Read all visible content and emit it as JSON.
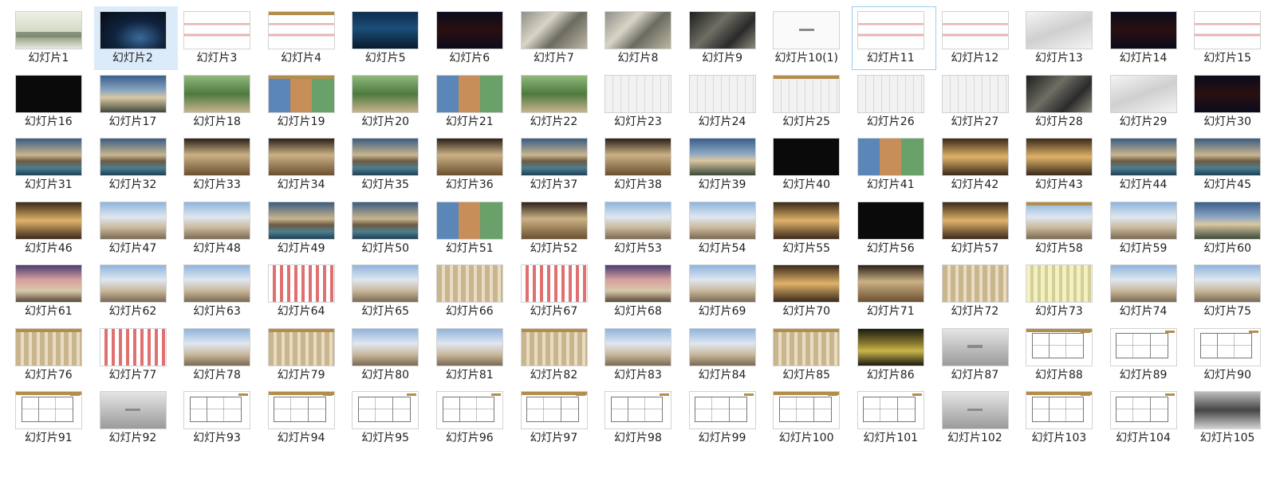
{
  "slide_prefix": "幻灯片",
  "selected_index": 1,
  "hover_index": 10,
  "slides": [
    {
      "label": "幻灯片1",
      "thumb": "fog"
    },
    {
      "label": "幻灯片2",
      "thumb": "night"
    },
    {
      "label": "幻灯片3",
      "thumb": "planred"
    },
    {
      "label": "幻灯片4",
      "thumb": "planred"
    },
    {
      "label": "幻灯片5",
      "thumb": "nightsky"
    },
    {
      "label": "幻灯片6",
      "thumb": "blueprint"
    },
    {
      "label": "幻灯片7",
      "thumb": "aerial"
    },
    {
      "label": "幻灯片8",
      "thumb": "aerial"
    },
    {
      "label": "幻灯片9",
      "thumb": "aerialdark"
    },
    {
      "label": "幻灯片10(1)",
      "thumb": "white"
    },
    {
      "label": "幻灯片11",
      "thumb": "planred"
    },
    {
      "label": "幻灯片12",
      "thumb": "planred"
    },
    {
      "label": "幻灯片13",
      "thumb": "axo"
    },
    {
      "label": "幻灯片14",
      "thumb": "blueprint"
    },
    {
      "label": "幻灯片15",
      "thumb": "planred"
    },
    {
      "label": "幻灯片16",
      "thumb": "dark"
    },
    {
      "label": "幻灯片17",
      "thumb": "dusk"
    },
    {
      "label": "幻灯片18",
      "thumb": "garden"
    },
    {
      "label": "幻灯片19",
      "thumb": "collage"
    },
    {
      "label": "幻灯片20",
      "thumb": "garden"
    },
    {
      "label": "幻灯片21",
      "thumb": "collage"
    },
    {
      "label": "幻灯片22",
      "thumb": "garden"
    },
    {
      "label": "幻灯片23",
      "thumb": "plan"
    },
    {
      "label": "幻灯片24",
      "thumb": "plan"
    },
    {
      "label": "幻灯片25",
      "thumb": "plan"
    },
    {
      "label": "幻灯片26",
      "thumb": "plan"
    },
    {
      "label": "幻灯片27",
      "thumb": "plan"
    },
    {
      "label": "幻灯片28",
      "thumb": "aerialdark"
    },
    {
      "label": "幻灯片29",
      "thumb": "axo"
    },
    {
      "label": "幻灯片30",
      "thumb": "blueprint"
    },
    {
      "label": "幻灯片31",
      "thumb": "pool"
    },
    {
      "label": "幻灯片32",
      "thumb": "pool"
    },
    {
      "label": "幻灯片33",
      "thumb": "lobby"
    },
    {
      "label": "幻灯片34",
      "thumb": "lobby"
    },
    {
      "label": "幻灯片35",
      "thumb": "pool"
    },
    {
      "label": "幻灯片36",
      "thumb": "lobby"
    },
    {
      "label": "幻灯片37",
      "thumb": "pool"
    },
    {
      "label": "幻灯片38",
      "thumb": "lobby"
    },
    {
      "label": "幻灯片39",
      "thumb": "dusk"
    },
    {
      "label": "幻灯片40",
      "thumb": "dark"
    },
    {
      "label": "幻灯片41",
      "thumb": "collage"
    },
    {
      "label": "幻灯片42",
      "thumb": "gold"
    },
    {
      "label": "幻灯片43",
      "thumb": "gold"
    },
    {
      "label": "幻灯片44",
      "thumb": "pool"
    },
    {
      "label": "幻灯片45",
      "thumb": "pool"
    },
    {
      "label": "幻灯片46",
      "thumb": "gold"
    },
    {
      "label": "幻灯片47",
      "thumb": "tower"
    },
    {
      "label": "幻灯片48",
      "thumb": "tower"
    },
    {
      "label": "幻灯片49",
      "thumb": "pool"
    },
    {
      "label": "幻灯片50",
      "thumb": "pool"
    },
    {
      "label": "幻灯片51",
      "thumb": "collage"
    },
    {
      "label": "幻灯片52",
      "thumb": "lobby"
    },
    {
      "label": "幻灯片53",
      "thumb": "tower"
    },
    {
      "label": "幻灯片54",
      "thumb": "tower"
    },
    {
      "label": "幻灯片55",
      "thumb": "gold"
    },
    {
      "label": "幻灯片56",
      "thumb": "dark"
    },
    {
      "label": "幻灯片57",
      "thumb": "gold"
    },
    {
      "label": "幻灯片58",
      "thumb": "tower"
    },
    {
      "label": "幻灯片59",
      "thumb": "tower"
    },
    {
      "label": "幻灯片60",
      "thumb": "dusk"
    },
    {
      "label": "幻灯片61",
      "thumb": "towerdusk"
    },
    {
      "label": "幻灯片62",
      "thumb": "tower"
    },
    {
      "label": "幻灯片63",
      "thumb": "tower"
    },
    {
      "label": "幻灯片64",
      "thumb": "facadered"
    },
    {
      "label": "幻灯片65",
      "thumb": "tower"
    },
    {
      "label": "幻灯片66",
      "thumb": "facade"
    },
    {
      "label": "幻灯片67",
      "thumb": "facadered"
    },
    {
      "label": "幻灯片68",
      "thumb": "towerdusk"
    },
    {
      "label": "幻灯片69",
      "thumb": "tower"
    },
    {
      "label": "幻灯片70",
      "thumb": "gold"
    },
    {
      "label": "幻灯片71",
      "thumb": "lobby"
    },
    {
      "label": "幻灯片72",
      "thumb": "facade"
    },
    {
      "label": "幻灯片73",
      "thumb": "facadeyel"
    },
    {
      "label": "幻灯片74",
      "thumb": "tower"
    },
    {
      "label": "幻灯片75",
      "thumb": "tower"
    },
    {
      "label": "幻灯片76",
      "thumb": "facade"
    },
    {
      "label": "幻灯片77",
      "thumb": "facadered"
    },
    {
      "label": "幻灯片78",
      "thumb": "tower"
    },
    {
      "label": "幻灯片79",
      "thumb": "facade"
    },
    {
      "label": "幻灯片80",
      "thumb": "tower"
    },
    {
      "label": "幻灯片81",
      "thumb": "tower"
    },
    {
      "label": "幻灯片82",
      "thumb": "facade"
    },
    {
      "label": "幻灯片83",
      "thumb": "tower"
    },
    {
      "label": "幻灯片84",
      "thumb": "tower"
    },
    {
      "label": "幻灯片85",
      "thumb": "facade"
    },
    {
      "label": "幻灯片86",
      "thumb": "cityeve"
    },
    {
      "label": "幻灯片87",
      "thumb": "gray"
    },
    {
      "label": "幻灯片88",
      "thumb": "floor"
    },
    {
      "label": "幻灯片89",
      "thumb": "floor"
    },
    {
      "label": "幻灯片90",
      "thumb": "floor"
    },
    {
      "label": "幻灯片91",
      "thumb": "floor"
    },
    {
      "label": "幻灯片92",
      "thumb": "gray"
    },
    {
      "label": "幻灯片93",
      "thumb": "floor"
    },
    {
      "label": "幻灯片94",
      "thumb": "floor"
    },
    {
      "label": "幻灯片95",
      "thumb": "floor"
    },
    {
      "label": "幻灯片96",
      "thumb": "floor"
    },
    {
      "label": "幻灯片97",
      "thumb": "floor"
    },
    {
      "label": "幻灯片98",
      "thumb": "floor"
    },
    {
      "label": "幻灯片99",
      "thumb": "floor"
    },
    {
      "label": "幻灯片100",
      "thumb": "floor"
    },
    {
      "label": "幻灯片101",
      "thumb": "floor"
    },
    {
      "label": "幻灯片102",
      "thumb": "gray"
    },
    {
      "label": "幻灯片103",
      "thumb": "floor"
    },
    {
      "label": "幻灯片104",
      "thumb": "floor"
    },
    {
      "label": "幻灯片105",
      "thumb": "bw"
    }
  ],
  "colors": {
    "selected_bg": "#dcebfa",
    "hover_border": "#99cef0",
    "accent_gold": "#b38d4a"
  }
}
